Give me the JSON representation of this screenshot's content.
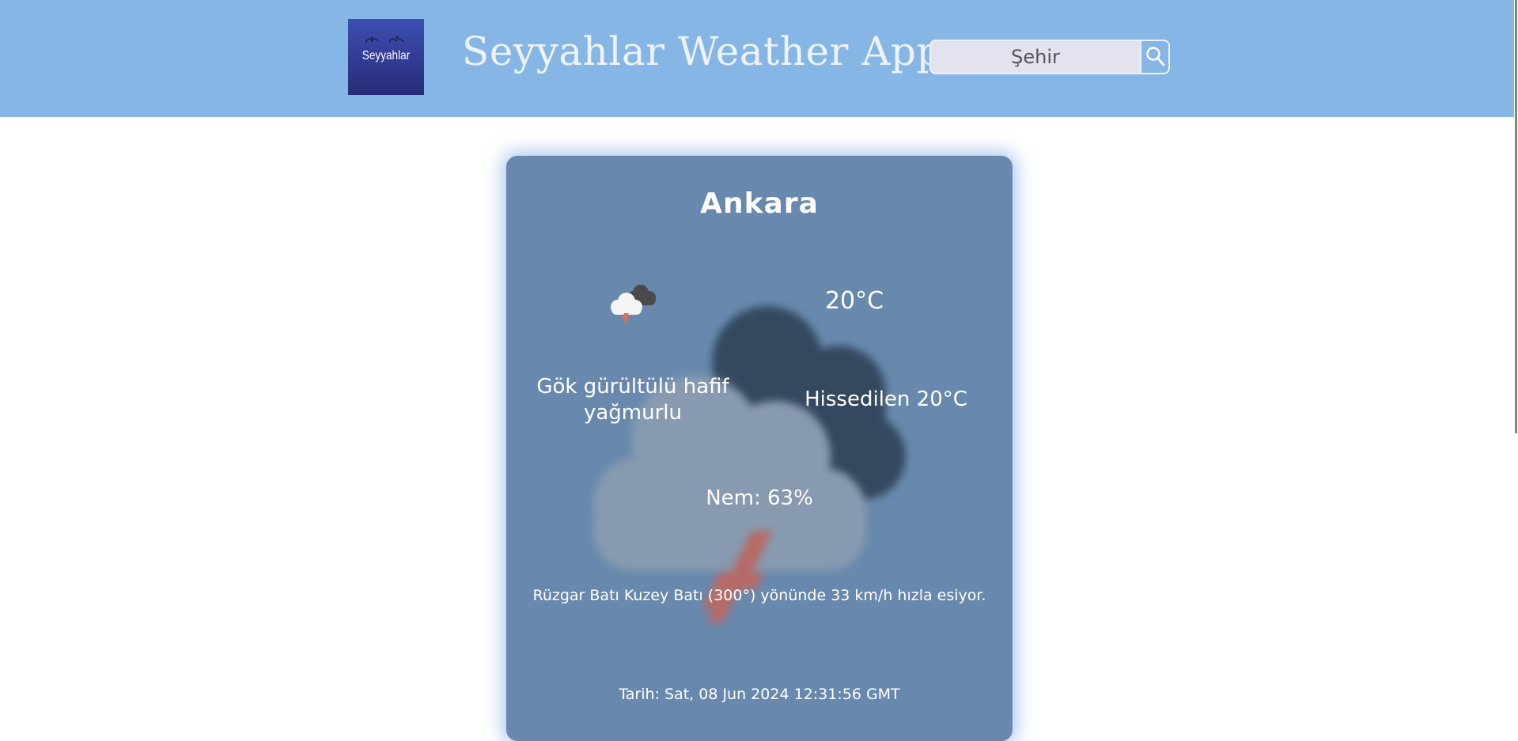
{
  "header": {
    "logo_text": "Seyyahlar",
    "title": "Seyyahlar Weather App",
    "search_placeholder": "Şehir",
    "background_color": "#86b6e5"
  },
  "icons": {
    "logo": "birds-logo",
    "search": "magnifier-icon",
    "weather": "thunder-cloud-rain-icon"
  },
  "weather": {
    "city": "Ankara",
    "temperature": "20°C",
    "description": "Gök gürültülü hafif yağmurlu",
    "feels_like": "Hissedilen 20°C",
    "humidity": "Nem: 63%",
    "wind": "Rüzgar Batı Kuzey Batı (300°) yönünde 33 km/h hızla esiyor.",
    "date": "Tarih: Sat, 08 Jun 2024 12:31:56 GMT"
  },
  "colors": {
    "card_background": "#6889ad",
    "text": "#ffffff"
  }
}
